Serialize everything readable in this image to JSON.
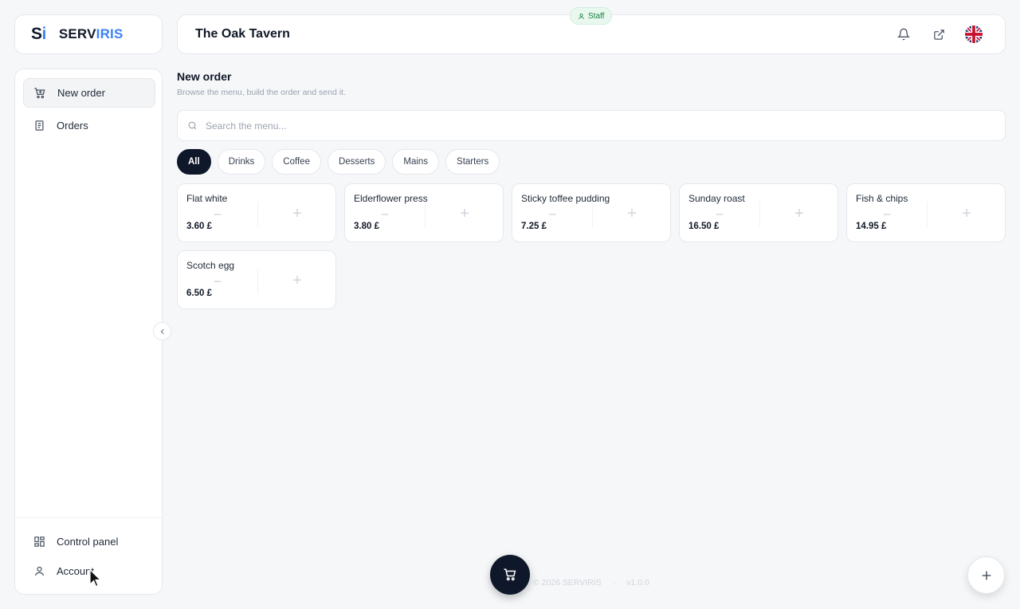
{
  "brand": {
    "mark_s": "S",
    "mark_i": "i",
    "name_1": "SERV",
    "name_2": "IRIS"
  },
  "header": {
    "venue": "The Oak Tavern",
    "role_badge": "Staff"
  },
  "sidebar": {
    "items": [
      {
        "label": "New order",
        "icon": "cart-icon",
        "active": true
      },
      {
        "label": "Orders",
        "icon": "receipt-icon"
      }
    ],
    "bottom_items": [
      {
        "label": "Control panel",
        "icon": "grid-icon"
      },
      {
        "label": "Account",
        "icon": "user-icon"
      }
    ]
  },
  "main": {
    "title": "New order",
    "subtitle": "Browse the menu, build the order and send it.",
    "search_placeholder": "Search the menu...",
    "categories": [
      "All",
      "Drinks",
      "Coffee",
      "Desserts",
      "Mains",
      "Starters"
    ],
    "selected_category": "All",
    "items": [
      {
        "name": "Flat white",
        "price": "3.60 £"
      },
      {
        "name": "Elderflower press",
        "price": "3.80 £"
      },
      {
        "name": "Sticky toffee pudding",
        "price": "7.25 £"
      },
      {
        "name": "Sunday roast",
        "price": "16.50 £"
      },
      {
        "name": "Fish & chips",
        "price": "14.95 £"
      },
      {
        "name": "Scotch egg",
        "price": "6.50 £"
      }
    ]
  },
  "footer": {
    "copyright": "© 2026 SERVIRIS",
    "separator": "·",
    "version": "v1.0.0"
  },
  "colors": {
    "accent": "#3b82f6",
    "dark": "#0f172a",
    "badge_green": "#15803d"
  }
}
